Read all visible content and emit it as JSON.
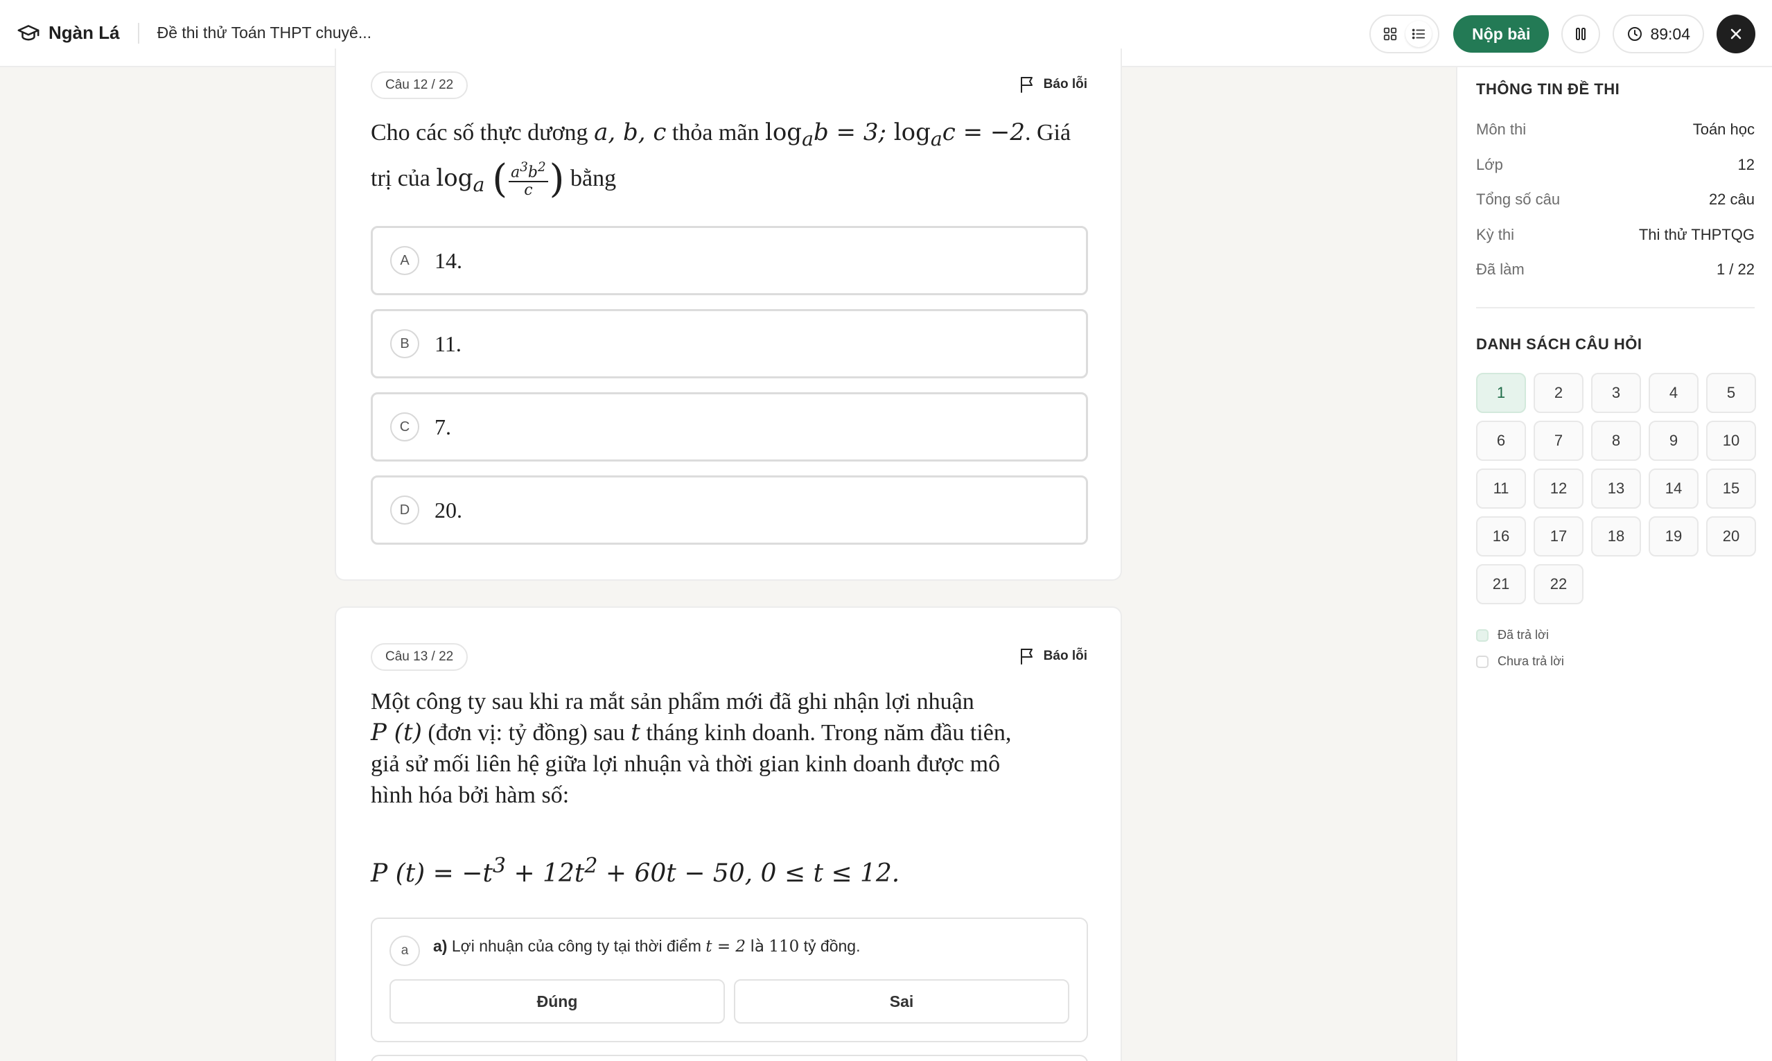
{
  "header": {
    "brand": "Ngàn Lá",
    "exam_title": "Đề thi thử Toán THPT chuyê...",
    "submit_label": "Nộp bài",
    "timer": "89:04"
  },
  "sidebar": {
    "info_title": "THÔNG TIN ĐỀ THI",
    "info": [
      {
        "key": "Môn thi",
        "value": "Toán học"
      },
      {
        "key": "Lớp",
        "value": "12"
      },
      {
        "key": "Tổng số câu",
        "value": "22 câu"
      },
      {
        "key": "Kỳ thi",
        "value": "Thi thử THPTQG"
      },
      {
        "key": "Đã làm",
        "value": "1 / 22"
      }
    ],
    "list_title": "DANH SÁCH CÂU HỎI",
    "questions": [
      "1",
      "2",
      "3",
      "4",
      "5",
      "6",
      "7",
      "8",
      "9",
      "10",
      "11",
      "12",
      "13",
      "14",
      "15",
      "16",
      "17",
      "18",
      "19",
      "20",
      "21",
      "22"
    ],
    "answered": [
      "1"
    ],
    "legend_answered": "Đã trả lời",
    "legend_unanswered": "Chưa trả lời"
  },
  "q12": {
    "counter": "Câu 12 / 22",
    "report": "Báo lỗi",
    "line1_prefix": "Cho các số thực dương",
    "line1_mid": "thỏa mãn",
    "line1_suffix": ". Giá",
    "line2_prefix": "trị của",
    "line2_suffix": "bằng",
    "options": [
      {
        "letter": "A",
        "text": "14."
      },
      {
        "letter": "B",
        "text": "11."
      },
      {
        "letter": "C",
        "text": "7."
      },
      {
        "letter": "D",
        "text": "20."
      }
    ]
  },
  "q13": {
    "counter": "Câu 13 / 22",
    "report": "Báo lỗi",
    "text_l1": "Một công ty sau khi ra mắt sản phẩm mới đã ghi nhận lợi nhuận",
    "text_l2": "(đơn vị: tỷ đồng) sau",
    "text_l2b": "tháng kinh doanh. Trong năm đầu tiên,",
    "text_l3": "giả sử mối liên hệ giữa lợi nhuận và thời gian kinh doanh được mô",
    "text_l4": "hình hóa bởi hàm số:",
    "sub_a": {
      "letter": "a",
      "label": "a)",
      "text_prefix": "Lợi nhuận của công ty tại thời điểm",
      "text_suffix": "tỷ đồng."
    },
    "true_label": "Đúng",
    "false_label": "Sai"
  }
}
